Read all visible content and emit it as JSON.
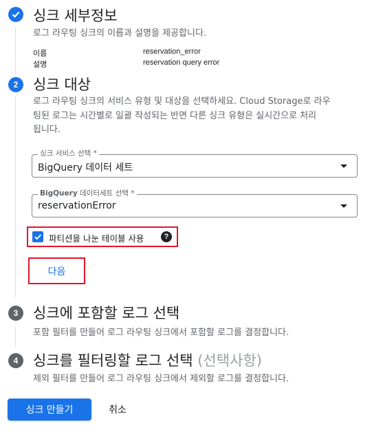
{
  "steps": {
    "step1": {
      "title": "싱크 세부정보",
      "description": "로그 라우팅 싱크의 이름과 설명을 제공합니다.",
      "details": [
        {
          "key": "이름",
          "value": "reservation_error"
        },
        {
          "key": "설명",
          "value": "reservation query error"
        }
      ]
    },
    "step2": {
      "number": "2",
      "title": "싱크 대상",
      "description_lines": [
        "로그 라우팅 싱크의 서비스 유형 및 대상을 선택하세요. Cloud Storage로 라우",
        "팅된 로그는 시간별로 일괄 작성되는 반면 다른 싱크 유형은 실시간으로 처리",
        "됩니다."
      ],
      "service_select": {
        "label": "싱크 서비스 선택 *",
        "value": "BigQuery 데이터 세트"
      },
      "dataset_select": {
        "label_bold": "BigQuery",
        "label_rest": " 데이터세트 선택 *",
        "value": "reservationError"
      },
      "checkbox_label": "파티션을 나눈 테이블 사용",
      "help_glyph": "?",
      "next_label": "다음"
    },
    "step3": {
      "number": "3",
      "title": "싱크에 포함할 로그 선택",
      "description": "포함 필터를 만들어 로그 라우팅 싱크에서 포함할 로그를 결정합니다."
    },
    "step4": {
      "number": "4",
      "title": "싱크를 필터링할 로그 선택 ",
      "optional": "(선택사항)",
      "description": "제외 필터를 만들어 로그 라우팅 싱크에서 제외할 로그를 결정합니다."
    }
  },
  "footer": {
    "create_label": "싱크 만들기",
    "cancel_label": "취소"
  },
  "icons": {
    "step1_icon": "check-circle-icon",
    "checkbox_icon": "check-icon",
    "help_icon": "help-icon",
    "caret_icon": "dropdown-arrow-icon"
  },
  "colors": {
    "primary": "#1a73e8",
    "step_inactive": "#5f6368",
    "highlight": "#e0142b",
    "optional_text": "#9aa0a6"
  }
}
